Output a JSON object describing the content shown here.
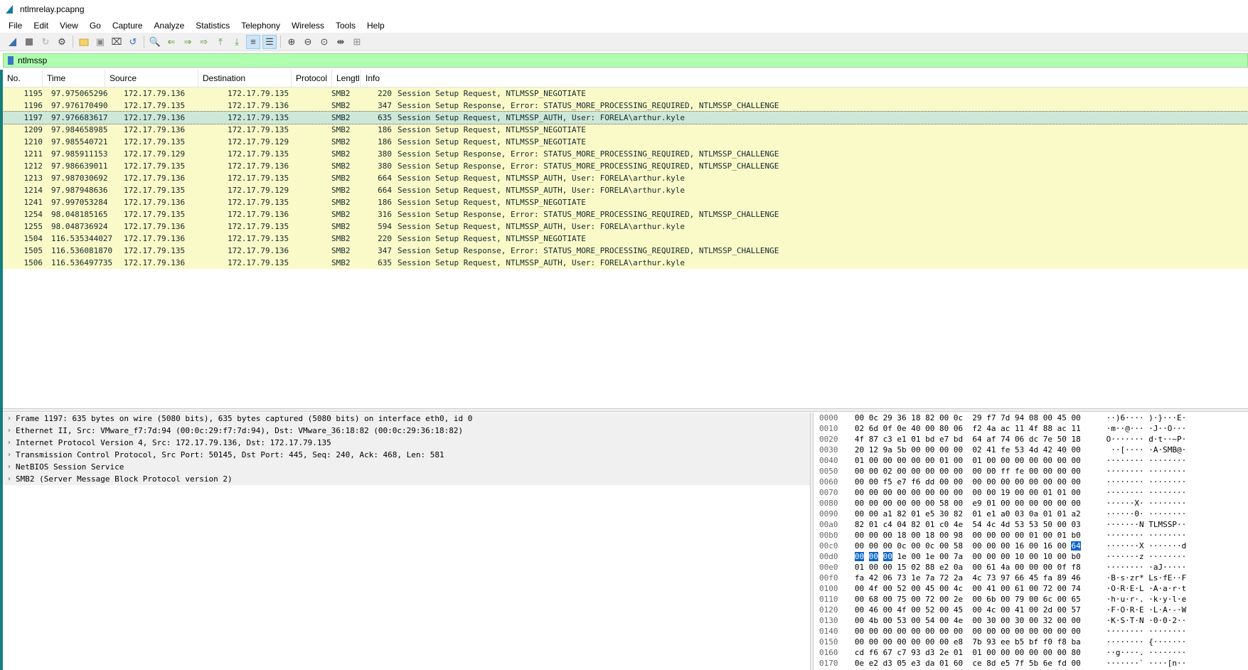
{
  "window": {
    "title": "ntlmrelay.pcapng"
  },
  "menu": [
    "File",
    "Edit",
    "View",
    "Go",
    "Capture",
    "Analyze",
    "Statistics",
    "Telephony",
    "Wireless",
    "Tools",
    "Help"
  ],
  "filter": {
    "value": "ntlmssp"
  },
  "columns": [
    "No.",
    "Time",
    "Source",
    "Destination",
    "Protocol",
    "Lengtl",
    "Info"
  ],
  "packets": [
    {
      "no": "1195",
      "time": "97.975065296",
      "src": "172.17.79.136",
      "dst": "172.17.79.135",
      "proto": "SMB2",
      "len": "220",
      "info": "Session Setup Request, NTLMSSP_NEGOTIATE"
    },
    {
      "no": "1196",
      "time": "97.976170490",
      "src": "172.17.79.135",
      "dst": "172.17.79.136",
      "proto": "SMB2",
      "len": "347",
      "info": "Session Setup Response, Error: STATUS_MORE_PROCESSING_REQUIRED, NTLMSSP_CHALLENGE"
    },
    {
      "no": "1197",
      "time": "97.976683617",
      "src": "172.17.79.136",
      "dst": "172.17.79.135",
      "proto": "SMB2",
      "len": "635",
      "info": "Session Setup Request, NTLMSSP_AUTH, User: FORELA\\arthur.kyle"
    },
    {
      "no": "1209",
      "time": "97.984658985",
      "src": "172.17.79.136",
      "dst": "172.17.79.135",
      "proto": "SMB2",
      "len": "186",
      "info": "Session Setup Request, NTLMSSP_NEGOTIATE"
    },
    {
      "no": "1210",
      "time": "97.985540721",
      "src": "172.17.79.135",
      "dst": "172.17.79.129",
      "proto": "SMB2",
      "len": "186",
      "info": "Session Setup Request, NTLMSSP_NEGOTIATE"
    },
    {
      "no": "1211",
      "time": "97.985911153",
      "src": "172.17.79.129",
      "dst": "172.17.79.135",
      "proto": "SMB2",
      "len": "380",
      "info": "Session Setup Response, Error: STATUS_MORE_PROCESSING_REQUIRED, NTLMSSP_CHALLENGE"
    },
    {
      "no": "1212",
      "time": "97.986639011",
      "src": "172.17.79.135",
      "dst": "172.17.79.136",
      "proto": "SMB2",
      "len": "380",
      "info": "Session Setup Response, Error: STATUS_MORE_PROCESSING_REQUIRED, NTLMSSP_CHALLENGE"
    },
    {
      "no": "1213",
      "time": "97.987030692",
      "src": "172.17.79.136",
      "dst": "172.17.79.135",
      "proto": "SMB2",
      "len": "664",
      "info": "Session Setup Request, NTLMSSP_AUTH, User: FORELA\\arthur.kyle"
    },
    {
      "no": "1214",
      "time": "97.987948636",
      "src": "172.17.79.135",
      "dst": "172.17.79.129",
      "proto": "SMB2",
      "len": "664",
      "info": "Session Setup Request, NTLMSSP_AUTH, User: FORELA\\arthur.kyle"
    },
    {
      "no": "1241",
      "time": "97.997053284",
      "src": "172.17.79.136",
      "dst": "172.17.79.135",
      "proto": "SMB2",
      "len": "186",
      "info": "Session Setup Request, NTLMSSP_NEGOTIATE"
    },
    {
      "no": "1254",
      "time": "98.048185165",
      "src": "172.17.79.135",
      "dst": "172.17.79.136",
      "proto": "SMB2",
      "len": "316",
      "info": "Session Setup Response, Error: STATUS_MORE_PROCESSING_REQUIRED, NTLMSSP_CHALLENGE"
    },
    {
      "no": "1255",
      "time": "98.048736924",
      "src": "172.17.79.136",
      "dst": "172.17.79.135",
      "proto": "SMB2",
      "len": "594",
      "info": "Session Setup Request, NTLMSSP_AUTH, User: FORELA\\arthur.kyle"
    },
    {
      "no": "1504",
      "time": "116.535344027",
      "src": "172.17.79.136",
      "dst": "172.17.79.135",
      "proto": "SMB2",
      "len": "220",
      "info": "Session Setup Request, NTLMSSP_NEGOTIATE"
    },
    {
      "no": "1505",
      "time": "116.536081870",
      "src": "172.17.79.135",
      "dst": "172.17.79.136",
      "proto": "SMB2",
      "len": "347",
      "info": "Session Setup Response, Error: STATUS_MORE_PROCESSING_REQUIRED, NTLMSSP_CHALLENGE"
    },
    {
      "no": "1506",
      "time": "116.536497735",
      "src": "172.17.79.136",
      "dst": "172.17.79.135",
      "proto": "SMB2",
      "len": "635",
      "info": "Session Setup Request, NTLMSSP_AUTH, User: FORELA\\arthur.kyle"
    }
  ],
  "selected_packet": "1197",
  "details": [
    "Frame 1197: 635 bytes on wire (5080 bits), 635 bytes captured (5080 bits) on interface eth0, id 0",
    "Ethernet II, Src: VMware_f7:7d:94 (00:0c:29:f7:7d:94), Dst: VMware_36:18:82 (00:0c:29:36:18:82)",
    "Internet Protocol Version 4, Src: 172.17.79.136, Dst: 172.17.79.135",
    "Transmission Control Protocol, Src Port: 50145, Dst Port: 445, Seq: 240, Ack: 468, Len: 581",
    "NetBIOS Session Service",
    "SMB2 (Server Message Block Protocol version 2)"
  ],
  "bytes": [
    {
      "off": "0000",
      "hex": "00 0c 29 36 18 82 00 0c  29 f7 7d 94 08 00 45 00",
      "asc": "··)6···· )·}···E·"
    },
    {
      "off": "0010",
      "hex": "02 6d 0f 0e 40 00 80 06  f2 4a ac 11 4f 88 ac 11",
      "asc": "·m··@··· ·J··O···"
    },
    {
      "off": "0020",
      "hex": "4f 87 c3 e1 01 bd e7 bd  64 af 74 06 dc 7e 50 18",
      "asc": "O······· d·t··~P·"
    },
    {
      "off": "0030",
      "hex": "20 12 9a 5b 00 00 00 00  02 41 fe 53 4d 42 40 00",
      "asc": " ··[···· ·A·SMB@·"
    },
    {
      "off": "0040",
      "hex": "01 00 00 00 00 00 01 00  01 00 00 00 00 00 00 00",
      "asc": "········ ········"
    },
    {
      "off": "0050",
      "hex": "00 00 02 00 00 00 00 00  00 00 ff fe 00 00 00 00",
      "asc": "········ ········"
    },
    {
      "off": "0060",
      "hex": "00 00 f5 e7 f6 dd 00 00  00 00 00 00 00 00 00 00",
      "asc": "········ ········"
    },
    {
      "off": "0070",
      "hex": "00 00 00 00 00 00 00 00  00 00 19 00 00 01 01 00",
      "asc": "········ ········"
    },
    {
      "off": "0080",
      "hex": "00 00 00 00 00 00 58 00  e9 01 00 00 00 00 00 00",
      "asc": "······X· ········"
    },
    {
      "off": "0090",
      "hex": "00 00 a1 82 01 e5 30 82  01 e1 a0 03 0a 01 01 a2",
      "asc": "······0· ········"
    },
    {
      "off": "00a0",
      "hex": "82 01 c4 04 82 01 c0 4e  54 4c 4d 53 53 50 00 03",
      "asc": "·······N TLMSSP··"
    },
    {
      "off": "00b0",
      "hex": "00 00 00 18 00 18 00 98  00 00 00 00 01 00 01 b0",
      "asc": "········ ········"
    },
    {
      "off": "00c0",
      "hex": "00 00 00 0c 00 0c 00 58  00 00 00 16 00 16 00 64",
      "asc": "·······X ·······d"
    },
    {
      "off": "00d0",
      "hex": "00 00 00 1e 00 1e 00 7a  00 00 00 10 00 10 00 b0",
      "asc": "·······z ········"
    },
    {
      "off": "00e0",
      "hex": "01 00 00 15 02 88 e2 0a  00 61 4a 00 00 00 0f f8",
      "asc": "········ ·aJ·····"
    },
    {
      "off": "00f0",
      "hex": "fa 42 06 73 1e 7a 72 2a  4c 73 97 66 45 fa 89 46",
      "asc": "·B·s·zr* Ls·fE··F"
    },
    {
      "off": "0100",
      "hex": "00 4f 00 52 00 45 00 4c  00 41 00 61 00 72 00 74",
      "asc": "·O·R·E·L ·A·a·r·t"
    },
    {
      "off": "0110",
      "hex": "00 68 00 75 00 72 00 2e  00 6b 00 79 00 6c 00 65",
      "asc": "·h·u·r·. ·k·y·l·e"
    },
    {
      "off": "0120",
      "hex": "00 46 00 4f 00 52 00 45  00 4c 00 41 00 2d 00 57",
      "asc": "·F·O·R·E ·L·A·-·W"
    },
    {
      "off": "0130",
      "hex": "00 4b 00 53 00 54 00 4e  00 30 00 30 00 32 00 00",
      "asc": "·K·S·T·N ·0·0·2··"
    },
    {
      "off": "0140",
      "hex": "00 00 00 00 00 00 00 00  00 00 00 00 00 00 00 00",
      "asc": "········ ········"
    },
    {
      "off": "0150",
      "hex": "00 00 00 00 00 00 00 e8  7b 93 ee b5 bf f0 f8 ba",
      "asc": "········ {·······"
    },
    {
      "off": "0160",
      "hex": "cd f6 67 c7 93 d3 2e 01  01 00 00 00 00 00 00 80",
      "asc": "··g····. ········"
    },
    {
      "off": "0170",
      "hex": "0e e2 d3 05 e3 da 01 60  ce 8d e5 7f 5b 6e fd 00",
      "asc": "·······` ····[n··"
    }
  ],
  "colors": {
    "row_bg": "#fafac8",
    "selected_bg": "#cde8d8",
    "filter_bg": "#afffaf",
    "highlight": "#0a64c8"
  }
}
